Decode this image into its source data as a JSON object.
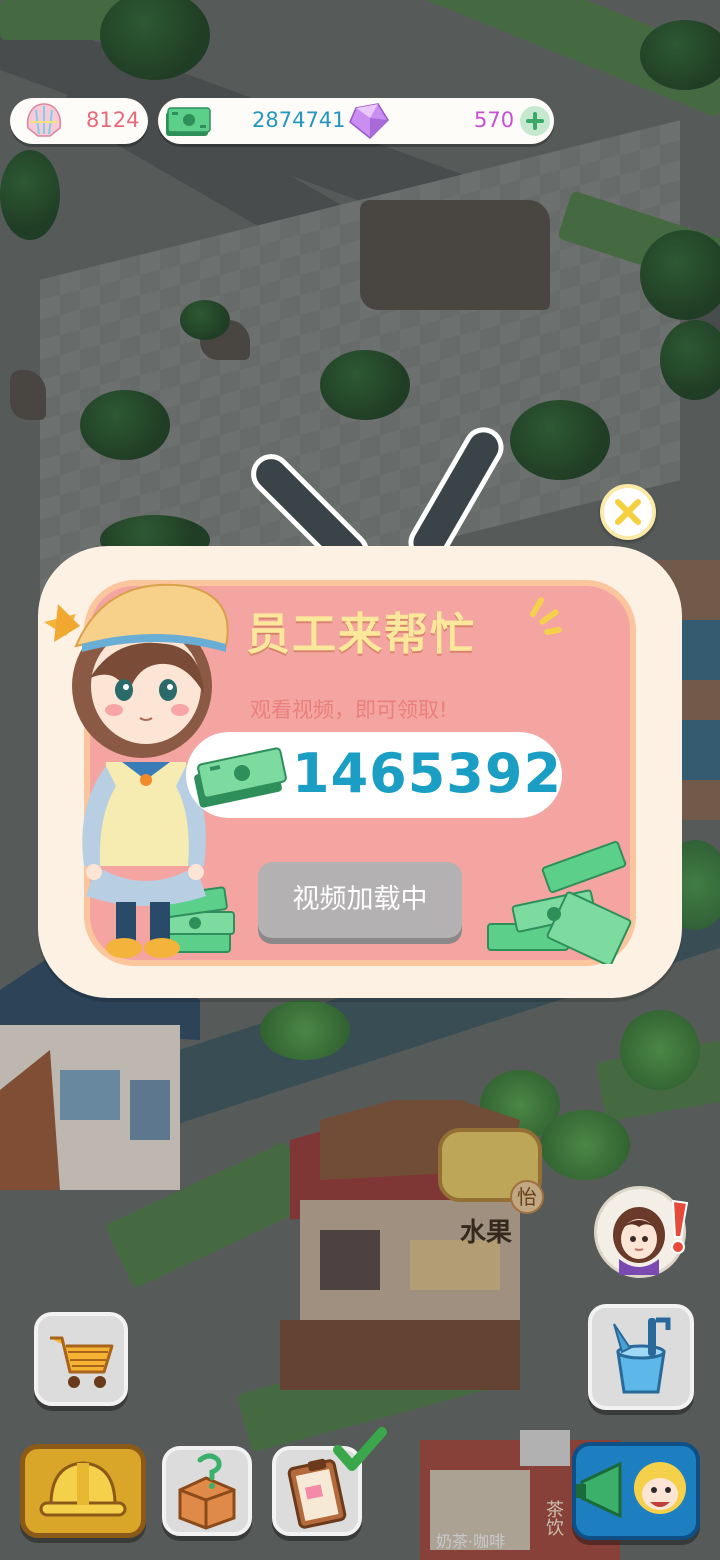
{
  "resources": {
    "shells": "8124",
    "cash": "2874741",
    "gems": "570"
  },
  "popup": {
    "title": "员工来帮忙",
    "subtitle": "观看视频，即可领取!",
    "reward_amount": "1465392",
    "video_button_label": "视频加载中"
  },
  "world_signs": {
    "fruit_shop": "水果",
    "fruit_shop_badge": "怡",
    "bottom_store": "奶茶·咖啡",
    "bottom_store_2": "茶饮"
  },
  "icons": {
    "shells": "shell-icon",
    "cash": "cash-icon",
    "gems": "gem-icon",
    "add": "plus-icon",
    "close": "close-icon",
    "shop": "shopping-cart-icon",
    "build": "hard-hat-icon",
    "mystery": "mystery-box-icon",
    "tasks": "clipboard-icon",
    "tools": "bucket-tools-icon",
    "promo": "megaphone-icon"
  },
  "colors": {
    "title": "#fbe89a",
    "reward_number": "#1a9ec4",
    "shell_count": "#e86a7a",
    "cash_count": "#2596be",
    "gem_count": "#c64fd6",
    "popup_pink": "#f4a5a2",
    "popup_frame": "#fdf1e3"
  }
}
